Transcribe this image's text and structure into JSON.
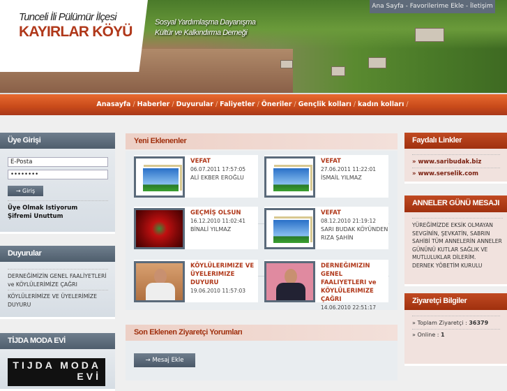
{
  "header": {
    "logo_line1": "Tunceli İli Pülümür İlçesi",
    "logo_line2": "KAYIRLAR KÖYÜ",
    "tagline1": "Sosyal Yardımlaşma Dayanışma",
    "tagline2": "Kültür ve Kalkındırma Derneği",
    "top_links": [
      "Ana Sayfa",
      "Favorilerime Ekle",
      "İletişim"
    ]
  },
  "nav": [
    "Anasayfa",
    "Haberler",
    "Duyurular",
    "Faliyetler",
    "Öneriler",
    "Gençlik kolları",
    "kadın kolları"
  ],
  "login": {
    "title": "Üye Girişi",
    "email": "E-Posta",
    "password": "••••••••",
    "button": "→ Giriş",
    "register": "Üye Olmak Istiyorum",
    "forgot": "Şifremi Unuttum"
  },
  "announcements": {
    "title": "Duyurular",
    "items": [
      "DERNEĞİMİZİN GENEL FAALİYETLERİ ve KÖYLÜLERİMİZE ÇAĞRI",
      "KÖYLÜLERİMİZE VE ÜYELERİMİZE DUYURU"
    ]
  },
  "sponsor": {
    "title": "TİJDA MODA EVİ",
    "logo_text": "TIJDA MODA EVİ"
  },
  "recent": {
    "title": "Yeni Eklenenler",
    "items": [
      {
        "title": "VEFAT",
        "date": "06.07.2011 17:57:05",
        "name": "ALİ EKBER EROĞLU",
        "thumb": "placeholder"
      },
      {
        "title": "VEFAT",
        "date": "27.06.2011 11:22:01",
        "name": "İSMAİL YILMAZ",
        "thumb": "placeholder"
      },
      {
        "title": "GEÇMİŞ OLSUN",
        "date": "16.12.2010 11:02:41",
        "name": "BİNALİ YILMAZ",
        "thumb": "roses"
      },
      {
        "title": "VEFAT",
        "date": "08.12.2010 21:19:12",
        "name": "SARI BUDAK KÖYÜNDEN RIZA ŞAHİN",
        "thumb": "placeholder"
      },
      {
        "title": "KÖYLÜLERIMIZE VE ÜYELERIMIZE DUYURU",
        "date": "19.06.2010 11:57:03",
        "name": "",
        "thumb": "photo"
      },
      {
        "title": "DERNEĞIMIZIN GENEL FAALIYETLERI ve KÖYLÜLERIMIZE ÇAĞRI",
        "date": "14.06.2010 22:51:17",
        "name": "",
        "thumb": "portrait"
      }
    ]
  },
  "guestbook": {
    "title": "Son Eklenen Ziyaretçi Yorumları",
    "button": "→ Mesaj Ekle"
  },
  "links": {
    "title": "Faydalı Linkler",
    "items": [
      "» www.saribudak.biz",
      "» www.serselik.com"
    ]
  },
  "mothers_day": {
    "title": "ANNELER GÜNÜ MESAJI",
    "text": "YÜREĞİMİZDE EKSİK OLMAYAN SEVGİNİN, ŞEVKATİN, SABRIN SAHİBİ TÜM ANNELERİN ANNELER GÜNÜNÜ KUTLAR SAĞLIK VE MUTLULUKLAR DİLERİM.",
    "signature": "DERNEK YÖBETİM KURULU"
  },
  "visitors": {
    "title": "Ziyaretçi Bilgiler",
    "total_label": "» Toplam Ziyaretçi :",
    "total": "36379",
    "online_label": "» Online :",
    "online": "1"
  }
}
